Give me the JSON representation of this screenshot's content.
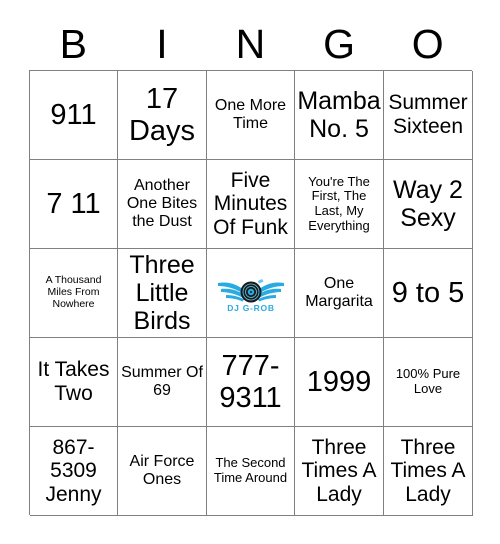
{
  "header": {
    "letters": [
      "B",
      "I",
      "N",
      "G",
      "O"
    ]
  },
  "grid": {
    "columns": 5,
    "rows": 5,
    "cells": [
      {
        "text": "911",
        "size": "fs-xxl"
      },
      {
        "text": "17 Days",
        "size": "fs-xxl"
      },
      {
        "text": "One More Time",
        "size": "fs-md"
      },
      {
        "text": "Mamba No. 5",
        "size": "fs-xl"
      },
      {
        "text": "Summer Sixteen",
        "size": "fs-lg"
      },
      {
        "text": "7 11",
        "size": "fs-xxl"
      },
      {
        "text": "Another One Bites the Dust",
        "size": "fs-md"
      },
      {
        "text": "Five Minutes Of Funk",
        "size": "fs-lg"
      },
      {
        "text": "You're The First, The Last, My Everything",
        "size": "fs-sm"
      },
      {
        "text": "Way 2 Sexy",
        "size": "fs-xl"
      },
      {
        "text": "A Thousand Miles From Nowhere",
        "size": "fs-xs"
      },
      {
        "text": "Three Little Birds",
        "size": "fs-xl"
      },
      {
        "text": "",
        "size": "fs-md",
        "free_space": true,
        "logo_text": "DJ G-ROB"
      },
      {
        "text": "One Margarita",
        "size": "fs-md"
      },
      {
        "text": "9 to 5",
        "size": "fs-xxl"
      },
      {
        "text": "It Takes Two",
        "size": "fs-lg"
      },
      {
        "text": "Summer Of 69",
        "size": "fs-md"
      },
      {
        "text": "777-9311",
        "size": "fs-xxl"
      },
      {
        "text": "1999",
        "size": "fs-xxl"
      },
      {
        "text": "100% Pure Love",
        "size": "fs-sm"
      },
      {
        "text": "867-5309 Jenny",
        "size": "fs-lg"
      },
      {
        "text": "Air Force Ones",
        "size": "fs-md"
      },
      {
        "text": "The Second Time Around",
        "size": "fs-sm"
      },
      {
        "text": "Three Times A Lady",
        "size": "fs-lg"
      },
      {
        "text": "Three Times A Lady",
        "size": "fs-lg"
      }
    ]
  },
  "colors": {
    "grid_line": "#808080",
    "text": "#000000",
    "background": "#ffffff",
    "logo_cyan": "#29ABE2",
    "logo_cyan_light": "#5FC8F0",
    "logo_dark": "#1A1A1A"
  }
}
